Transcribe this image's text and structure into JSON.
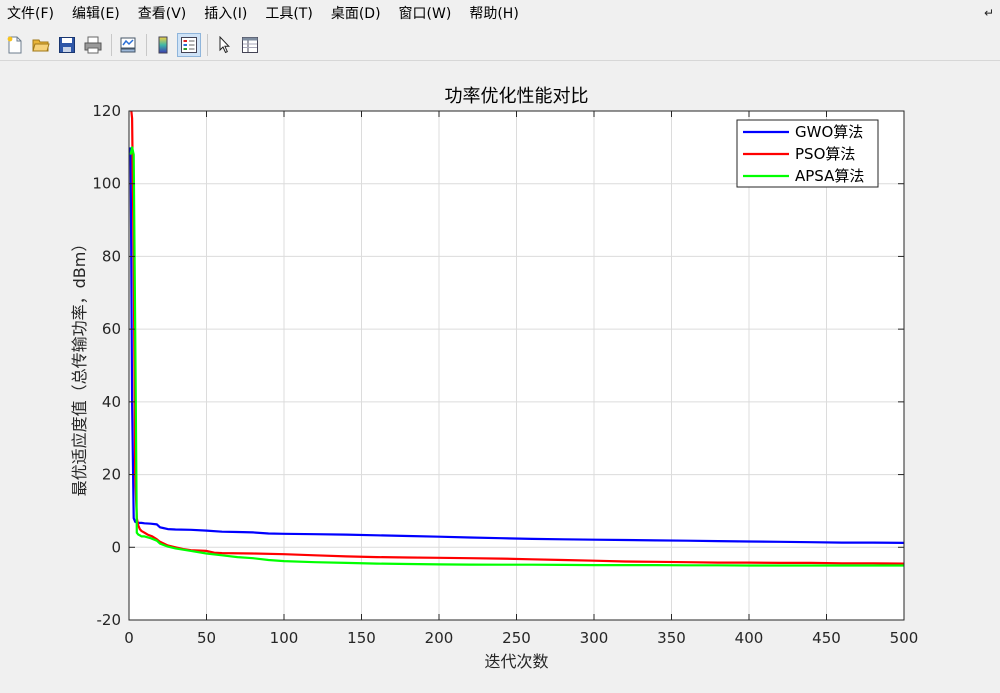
{
  "menu": {
    "items": [
      "文件(F)",
      "编辑(E)",
      "查看(V)",
      "插入(I)",
      "工具(T)",
      "桌面(D)",
      "窗口(W)",
      "帮助(H)"
    ]
  },
  "toolbar": {
    "buttons": [
      "new-figure",
      "open-file",
      "save",
      "print",
      "link-plot",
      "insert-colorbar",
      "insert-legend",
      "edit-plot",
      "property-inspector"
    ]
  },
  "chart_data": {
    "type": "line",
    "title": "功率优化性能对比",
    "xlabel": "迭代次数",
    "ylabel": "最优适应度值（总传输功率，dBm）",
    "xlim": [
      0,
      500
    ],
    "ylim": [
      -20,
      120
    ],
    "xticks": [
      0,
      50,
      100,
      150,
      200,
      250,
      300,
      350,
      400,
      450,
      500
    ],
    "yticks": [
      -20,
      0,
      20,
      40,
      60,
      80,
      100,
      120
    ],
    "grid": true,
    "legend_position": "top-right",
    "series": [
      {
        "name": "GWO算法",
        "color": "#0000ff",
        "x": [
          1,
          2,
          3,
          4,
          5,
          6,
          8,
          10,
          14,
          18,
          20,
          22,
          25,
          30,
          40,
          50,
          60,
          70,
          80,
          90,
          100,
          120,
          140,
          160,
          180,
          200,
          220,
          240,
          260,
          280,
          300,
          320,
          340,
          360,
          380,
          400,
          420,
          440,
          460,
          480,
          500
        ],
        "y": [
          110,
          40,
          8,
          7,
          6.8,
          6.7,
          6.7,
          6.6,
          6.5,
          6.3,
          5.5,
          5.3,
          5.0,
          4.9,
          4.8,
          4.6,
          4.3,
          4.2,
          4.1,
          3.8,
          3.7,
          3.6,
          3.5,
          3.3,
          3.1,
          2.9,
          2.7,
          2.5,
          2.3,
          2.2,
          2.1,
          2.0,
          1.9,
          1.8,
          1.7,
          1.6,
          1.5,
          1.4,
          1.3,
          1.3,
          1.2
        ]
      },
      {
        "name": "PSO算法",
        "color": "#ff0000",
        "x": [
          1,
          2,
          3,
          4,
          5,
          6,
          7,
          8,
          10,
          12,
          15,
          18,
          20,
          25,
          30,
          35,
          40,
          50,
          55,
          60,
          80,
          100,
          120,
          140,
          160,
          180,
          200,
          220,
          240,
          260,
          280,
          300,
          320,
          340,
          360,
          380,
          400,
          420,
          440,
          460,
          480,
          500
        ],
        "y": [
          122,
          118,
          80,
          20,
          8,
          6,
          5,
          4.5,
          4,
          3.5,
          3,
          2.2,
          1.5,
          0.5,
          0,
          -0.5,
          -0.8,
          -1.0,
          -1.5,
          -1.6,
          -1.7,
          -1.9,
          -2.2,
          -2.5,
          -2.7,
          -2.8,
          -2.9,
          -3.0,
          -3.1,
          -3.3,
          -3.5,
          -3.7,
          -3.9,
          -4.0,
          -4.1,
          -4.2,
          -4.2,
          -4.3,
          -4.3,
          -4.4,
          -4.4,
          -4.5
        ]
      },
      {
        "name": "APSA算法",
        "color": "#00ff00",
        "x": [
          1,
          2,
          3,
          4,
          5,
          6,
          7,
          8,
          10,
          14,
          18,
          20,
          25,
          30,
          40,
          50,
          60,
          70,
          80,
          90,
          100,
          120,
          140,
          160,
          180,
          200,
          220,
          240,
          260,
          280,
          300,
          320,
          340,
          360,
          380,
          400,
          420,
          440,
          460,
          480,
          500
        ],
        "y": [
          108,
          110,
          108,
          60,
          4,
          3.5,
          3.3,
          3.0,
          3.0,
          2.5,
          1.8,
          1.0,
          0.2,
          -0.3,
          -1.0,
          -1.7,
          -2.2,
          -2.7,
          -3.0,
          -3.5,
          -3.8,
          -4.1,
          -4.3,
          -4.5,
          -4.6,
          -4.7,
          -4.75,
          -4.8,
          -4.8,
          -4.85,
          -4.9,
          -4.9,
          -4.9,
          -4.95,
          -4.95,
          -5.0,
          -5.0,
          -5.0,
          -5.0,
          -5.0,
          -5.0
        ]
      }
    ]
  }
}
